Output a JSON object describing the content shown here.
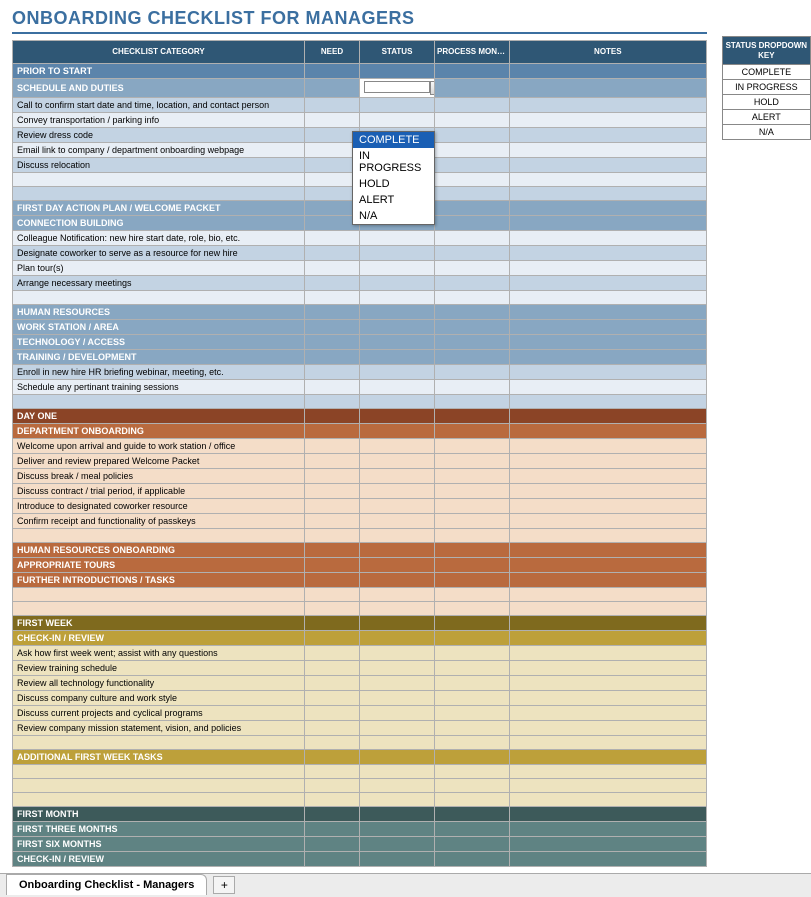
{
  "title": "ONBOARDING CHECKLIST FOR MANAGERS",
  "columns": {
    "category": "CHECKLIST CATEGORY",
    "need": "NEED",
    "status": "STATUS",
    "process": "PROCESS MONITOR/MENTOR (If Applicable)",
    "notes": "NOTES"
  },
  "key": {
    "header": "STATUS DROPDOWN KEY",
    "items": [
      "COMPLETE",
      "IN PROGRESS",
      "HOLD",
      "ALERT",
      "N/A"
    ]
  },
  "dropdown": {
    "items": [
      "COMPLETE",
      "IN PROGRESS",
      "HOLD",
      "ALERT",
      "N/A"
    ],
    "selected": "COMPLETE"
  },
  "rows": [
    {
      "cls": "blue-dark",
      "text": "PRIOR TO START"
    },
    {
      "cls": "blue-med",
      "text": "SCHEDULE AND DUTIES",
      "status_active": true
    },
    {
      "cls": "blue-light",
      "text": "Call to confirm start date and time, location, and contact person"
    },
    {
      "cls": "blue-striped",
      "text": "Convey transportation / parking info"
    },
    {
      "cls": "blue-light",
      "text": "Review dress code"
    },
    {
      "cls": "blue-striped",
      "text": "Email link to company / department onboarding webpage"
    },
    {
      "cls": "blue-light",
      "text": "Discuss relocation"
    },
    {
      "cls": "blue-striped",
      "text": ""
    },
    {
      "cls": "blue-light",
      "text": ""
    },
    {
      "cls": "blue-med",
      "text": "FIRST DAY ACTION PLAN / WELCOME PACKET"
    },
    {
      "cls": "blue-med",
      "text": "CONNECTION BUILDING"
    },
    {
      "cls": "blue-striped",
      "text": "Colleague Notification: new hire start date, role, bio, etc."
    },
    {
      "cls": "blue-light",
      "text": "Designate coworker to serve as a resource for new hire"
    },
    {
      "cls": "blue-striped",
      "text": "Plan tour(s)"
    },
    {
      "cls": "blue-light",
      "text": "Arrange necessary meetings"
    },
    {
      "cls": "blue-striped",
      "text": ""
    },
    {
      "cls": "blue-med",
      "text": "HUMAN RESOURCES"
    },
    {
      "cls": "blue-med",
      "text": "WORK STATION / AREA"
    },
    {
      "cls": "blue-med",
      "text": "TECHNOLOGY / ACCESS"
    },
    {
      "cls": "blue-med",
      "text": "TRAINING / DEVELOPMENT"
    },
    {
      "cls": "blue-light",
      "text": "Enroll in new hire HR briefing webinar, meeting, etc."
    },
    {
      "cls": "blue-striped",
      "text": "Schedule any pertinant training sessions"
    },
    {
      "cls": "blue-light",
      "text": ""
    },
    {
      "cls": "brown-dark",
      "text": "DAY ONE"
    },
    {
      "cls": "brown-med",
      "text": "DEPARTMENT ONBOARDING"
    },
    {
      "cls": "peach",
      "text": "Welcome upon arrival and guide to work station / office"
    },
    {
      "cls": "peach",
      "text": "Deliver and review prepared Welcome Packet"
    },
    {
      "cls": "peach",
      "text": "Discuss break / meal policies"
    },
    {
      "cls": "peach",
      "text": "Discuss contract / trial period, if applicable"
    },
    {
      "cls": "peach",
      "text": "Introduce to designated coworker resource"
    },
    {
      "cls": "peach",
      "text": "Confirm receipt and functionality of passkeys"
    },
    {
      "cls": "peach",
      "text": ""
    },
    {
      "cls": "brown-med",
      "text": "HUMAN RESOURCES ONBOARDING"
    },
    {
      "cls": "brown-med",
      "text": "APPROPRIATE TOURS"
    },
    {
      "cls": "brown-med",
      "text": "FURTHER INTRODUCTIONS / TASKS"
    },
    {
      "cls": "peach",
      "text": ""
    },
    {
      "cls": "peach",
      "text": ""
    },
    {
      "cls": "olive-dark",
      "text": "FIRST WEEK"
    },
    {
      "cls": "olive-med",
      "text": "CHECK-IN / REVIEW"
    },
    {
      "cls": "olive-light",
      "text": "Ask how first week went; assist with any questions"
    },
    {
      "cls": "olive-light",
      "text": "Review training schedule"
    },
    {
      "cls": "olive-light",
      "text": "Review all technology functionality"
    },
    {
      "cls": "olive-light",
      "text": "Discuss company culture and work style"
    },
    {
      "cls": "olive-light",
      "text": "Discuss current projects and cyclical programs"
    },
    {
      "cls": "olive-light",
      "text": "Review company mission statement, vision, and policies"
    },
    {
      "cls": "olive-light",
      "text": ""
    },
    {
      "cls": "olive-med",
      "text": "ADDITIONAL FIRST WEEK TASKS"
    },
    {
      "cls": "olive-light",
      "text": ""
    },
    {
      "cls": "olive-light",
      "text": ""
    },
    {
      "cls": "olive-light",
      "text": ""
    },
    {
      "cls": "teal-dark",
      "text": "FIRST MONTH"
    },
    {
      "cls": "teal-med",
      "text": "FIRST THREE MONTHS"
    },
    {
      "cls": "teal-med",
      "text": "FIRST SIX MONTHS"
    },
    {
      "cls": "teal-med",
      "text": "CHECK-IN / REVIEW"
    }
  ],
  "tab": "Onboarding Checklist - Managers"
}
